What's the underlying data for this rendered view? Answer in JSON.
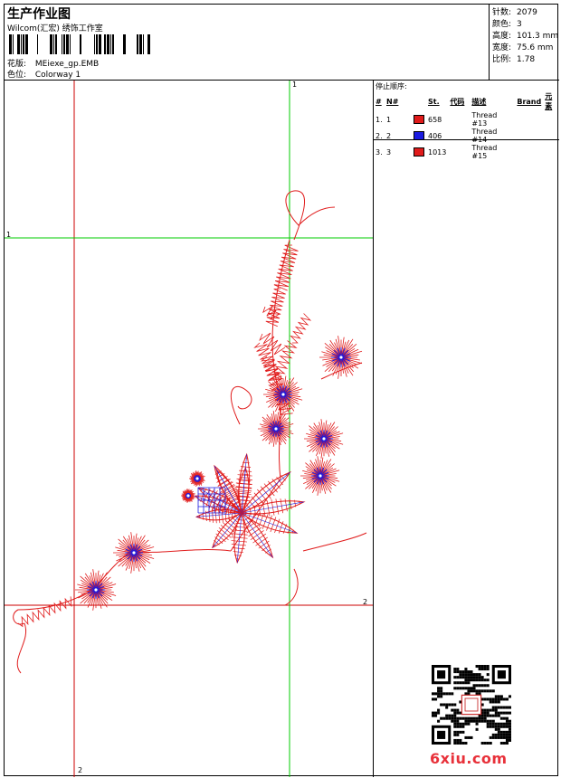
{
  "header": {
    "title": "生产作业图",
    "company": "Wilcom(汇宏) 绣饰工作室",
    "design_label": "花版:",
    "design_value": "MEiexe_gp.EMB",
    "colorway_label": "色位:",
    "colorway_value": "Colorway 1"
  },
  "stats": [
    {
      "label": "针数:",
      "value": "2079"
    },
    {
      "label": "颜色:",
      "value": "3"
    },
    {
      "label": "高度:",
      "value": "101.3 mm"
    },
    {
      "label": "宽度:",
      "value": "75.6 mm"
    },
    {
      "label": "比例:",
      "value": "1.78"
    }
  ],
  "stop_sequence": {
    "heading": "停止顺序:",
    "columns": [
      "#",
      "N#",
      "St.",
      "代码",
      "描述",
      "Brand",
      "元素"
    ],
    "rows": [
      {
        "idx": "1.",
        "n": "1",
        "color": "#e01b1b",
        "stitches": "658",
        "code": "",
        "desc": "Thread #13",
        "brand": "",
        "element": ""
      },
      {
        "idx": "2.",
        "n": "2",
        "color": "#1b1be0",
        "stitches": "406",
        "code": "",
        "desc": "Thread #14",
        "brand": "",
        "element": ""
      },
      {
        "idx": "3.",
        "n": "3",
        "color": "#e01b1b",
        "stitches": "1013",
        "code": "",
        "desc": "Thread #15",
        "brand": "",
        "element": ""
      }
    ]
  },
  "guides": {
    "top_label": "1",
    "left_label": "1",
    "right_label": "2",
    "bottom_label": "2"
  },
  "watermark": "6xiu.com",
  "colors": {
    "red": "#e01b1b",
    "blue": "#1b1be0",
    "guide_green": "#00cc00",
    "guide_red": "#cc0000"
  }
}
